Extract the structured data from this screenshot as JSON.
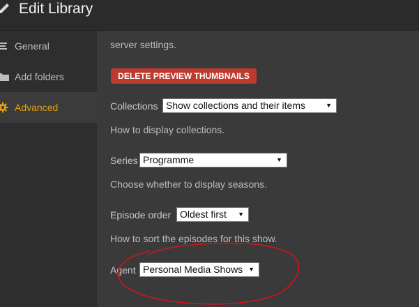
{
  "header": {
    "title": "Edit Library"
  },
  "sidebar": {
    "items": [
      {
        "label": "General",
        "icon": "list-icon",
        "active": false
      },
      {
        "label": "Add folders",
        "icon": "folder-icon",
        "active": false
      },
      {
        "label": "Advanced",
        "icon": "gear-icon",
        "active": true
      }
    ]
  },
  "content": {
    "intro_tail": "server settings.",
    "delete_button": "DELETE PREVIEW THUMBNAILS",
    "collections": {
      "label": "Collections",
      "value": "Show collections and their items",
      "help": "How to display collections."
    },
    "series": {
      "label": "Series",
      "value": "Programme",
      "help": "Choose whether to display seasons."
    },
    "episode_order": {
      "label": "Episode order",
      "value": "Oldest first",
      "help": "How to sort the episodes for this show."
    },
    "agent": {
      "label": "Agent",
      "value": "Personal Media Shows"
    }
  },
  "colors": {
    "accent": "#e5a00d",
    "danger": "#bd3a2e",
    "annotation": "#d0141a"
  }
}
